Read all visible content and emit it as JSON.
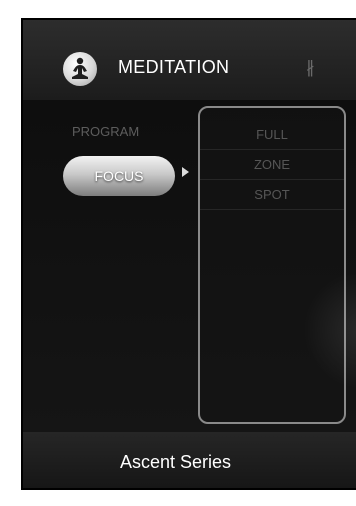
{
  "header": {
    "title": "MEDITATION",
    "logo_icon": "meditation-figure-icon",
    "status_icon": "bluetooth-icon",
    "bluetooth_glyph": "∦"
  },
  "menu": {
    "program_label": "PROGRAM",
    "selected_label": "FOCUS",
    "options": [
      "FULL",
      "ZONE",
      "SPOT"
    ]
  },
  "footer": {
    "series": "Ascent Series"
  }
}
